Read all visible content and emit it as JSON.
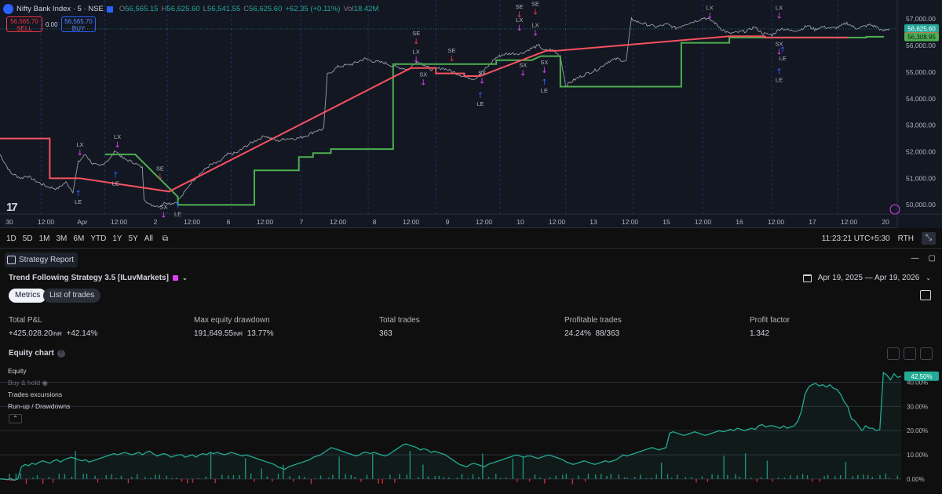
{
  "chart_header": {
    "symbol": "Nifty Bank Index · 5 · NSE",
    "open_label": "O",
    "open": "56,565.15",
    "high_label": "H",
    "high": "56,625.60",
    "low_label": "L",
    "low": "56,541.55",
    "close_label": "C",
    "close": "56,625.60",
    "change": "+62.35 (+0.11%)",
    "vol_label": "Vol",
    "vol": "18.42M",
    "sell_price": "56,565.70",
    "sell_label": "SELL",
    "buy_price": "56,565.70",
    "buy_label": "BUY",
    "spread": "0.00"
  },
  "price_axis": {
    "ticks": [
      "57,000.00",
      "56,000.00",
      "55,000.00",
      "54,000.00",
      "53,000.00",
      "52,000.00",
      "51,000.00",
      "50,000.00"
    ],
    "last_price": "56,625.60",
    "red_level": "56,324.00",
    "green_level": "56,308.95"
  },
  "time_axis": {
    "labels": [
      "30",
      "12:00",
      "Apr",
      "12:00",
      "2",
      "12:00",
      "6",
      "12:00",
      "7",
      "12:00",
      "8",
      "12:00",
      "9",
      "12:00",
      "10",
      "12:00",
      "13",
      "12:00",
      "15",
      "12:00",
      "16",
      "12:00",
      "17",
      "12:00",
      "20"
    ]
  },
  "signals": {
    "le": "LE",
    "lx": "LX",
    "se": "SE",
    "sx": "SX"
  },
  "chart_data": {
    "type": "line",
    "title": "Nifty Bank Index · 5 · NSE",
    "ylim": [
      49800,
      57300
    ],
    "price_path": [
      [
        0,
        51900
      ],
      [
        0.6,
        51200
      ],
      [
        1.2,
        51000
      ],
      [
        1.5,
        51100
      ],
      [
        2,
        50900
      ],
      [
        2.6,
        50700
      ],
      [
        3.2,
        50600
      ],
      [
        3.7,
        50850
      ],
      [
        4.1,
        50500
      ],
      [
        4.4,
        51600
      ],
      [
        4.8,
        51900
      ],
      [
        5.2,
        51550
      ],
      [
        5.6,
        51450
      ],
      [
        6.2,
        51750
      ],
      [
        6.5,
        52050
      ],
      [
        6.9,
        51750
      ],
      [
        7.5,
        51600
      ],
      [
        8,
        51400
      ],
      [
        8.1,
        50250
      ],
      [
        8.4,
        50000
      ],
      [
        9,
        49950
      ],
      [
        9.3,
        50100
      ],
      [
        9.6,
        50050
      ],
      [
        9.9,
        50100
      ],
      [
        10.2,
        50300
      ],
      [
        10.8,
        50900
      ],
      [
        11.3,
        51200
      ],
      [
        11.8,
        51500
      ],
      [
        12.3,
        51600
      ],
      [
        12.8,
        51900
      ],
      [
        13.3,
        51950
      ],
      [
        13.8,
        52200
      ],
      [
        14.3,
        52400
      ],
      [
        14.9,
        52600
      ],
      [
        15.6,
        52400
      ],
      [
        16.1,
        52500
      ],
      [
        16.7,
        52500
      ],
      [
        17.2,
        52600
      ],
      [
        17.8,
        52800
      ],
      [
        18.2,
        52850
      ],
      [
        18.4,
        54900
      ],
      [
        19,
        55200
      ],
      [
        19.8,
        55300
      ],
      [
        20.5,
        55500
      ],
      [
        21,
        55400
      ],
      [
        21.6,
        55350
      ],
      [
        22.2,
        55200
      ],
      [
        23,
        55100
      ],
      [
        23.4,
        55400
      ],
      [
        23.8,
        55300
      ],
      [
        24.2,
        55100
      ],
      [
        24.9,
        55150
      ],
      [
        25.5,
        55000
      ],
      [
        26.2,
        54800
      ],
      [
        26.7,
        54750
      ],
      [
        27.1,
        55000
      ],
      [
        27.5,
        55250
      ],
      [
        27.8,
        55500
      ],
      [
        28.2,
        55650
      ],
      [
        28.7,
        55700
      ],
      [
        29.3,
        55700
      ],
      [
        29.9,
        55900
      ],
      [
        30.3,
        56000
      ],
      [
        30.6,
        55800
      ],
      [
        31,
        55850
      ],
      [
        31.5,
        55600
      ],
      [
        31.8,
        54500
      ],
      [
        32.4,
        54750
      ],
      [
        33,
        54950
      ],
      [
        33.6,
        55100
      ],
      [
        34.2,
        55400
      ],
      [
        34.7,
        55500
      ],
      [
        35.2,
        55400
      ],
      [
        35.5,
        57000
      ],
      [
        35.8,
        56900
      ],
      [
        36.3,
        56800
      ],
      [
        36.9,
        56700
      ],
      [
        37.5,
        56800
      ],
      [
        38,
        56650
      ],
      [
        38.5,
        56800
      ],
      [
        39,
        56900
      ],
      [
        39.6,
        57050
      ],
      [
        40.1,
        56900
      ],
      [
        40.6,
        56600
      ],
      [
        41,
        56450
      ],
      [
        41.5,
        56500
      ],
      [
        42,
        56550
      ],
      [
        42.4,
        56700
      ],
      [
        42.9,
        56450
      ],
      [
        43.4,
        56400
      ],
      [
        43.9,
        56650
      ],
      [
        44.5,
        56550
      ],
      [
        45,
        56600
      ],
      [
        45.4,
        56750
      ],
      [
        45.8,
        56600
      ],
      [
        46.2,
        56700
      ],
      [
        46.8,
        56650
      ],
      [
        47.2,
        56700
      ],
      [
        47.6,
        56850
      ],
      [
        48.1,
        56650
      ],
      [
        48.5,
        56700
      ],
      [
        48.9,
        56780
      ],
      [
        49.3,
        56700
      ],
      [
        49.6,
        56540
      ],
      [
        50,
        56625
      ]
    ],
    "red_stop": [
      [
        0,
        52500
      ],
      [
        2.8,
        52500
      ],
      [
        2.8,
        51000
      ],
      [
        4.5,
        51000
      ],
      [
        9.5,
        50500
      ],
      [
        23.1,
        55150
      ],
      [
        24.5,
        55150
      ],
      [
        24.5,
        54950
      ],
      [
        26.1,
        54950
      ],
      [
        26.1,
        54850
      ],
      [
        27,
        54850
      ],
      [
        30.7,
        55800
      ],
      [
        31.3,
        55800
      ],
      [
        41,
        56350
      ],
      [
        43,
        56350
      ],
      [
        43,
        56300
      ],
      [
        47.7,
        56300
      ]
    ],
    "green_stop": [
      [
        5.9,
        51900
      ],
      [
        6.8,
        51900
      ],
      [
        7.6,
        51900
      ],
      [
        10,
        50300
      ],
      [
        10,
        50000
      ],
      [
        14.3,
        50000
      ],
      [
        14.3,
        51300
      ],
      [
        16.8,
        51300
      ],
      [
        16.8,
        51800
      ],
      [
        17.6,
        51800
      ],
      [
        17.6,
        51950
      ],
      [
        18.6,
        51950
      ],
      [
        18.6,
        52100
      ],
      [
        22.1,
        52100
      ],
      [
        22.1,
        55300
      ],
      [
        24.5,
        55300
      ],
      [
        27.9,
        55300
      ],
      [
        27.9,
        55450
      ],
      [
        29.9,
        55450
      ],
      [
        30.4,
        55600
      ],
      [
        31.5,
        55600
      ],
      [
        31.5,
        54450
      ],
      [
        38.3,
        54450
      ],
      [
        38.3,
        56100
      ],
      [
        41,
        56100
      ],
      [
        41,
        56300
      ],
      [
        47.6,
        56300
      ],
      [
        47.7,
        56300
      ],
      [
        48.7,
        56300
      ],
      [
        48.7,
        56330
      ],
      [
        49.7,
        56330
      ]
    ]
  },
  "timeframes": [
    "1D",
    "5D",
    "1M",
    "3M",
    "6M",
    "YTD",
    "1Y",
    "5Y",
    "All"
  ],
  "time_toolbar": {
    "clock": "11:23:21 UTC+5:30",
    "session": "RTH"
  },
  "report": {
    "tab_label": "Strategy Report",
    "strategy_name": "Trend Following Strategy 3.5 [ILuvMarkets]",
    "date_range": "Apr 19, 2025 — Apr 19, 2026",
    "tabs": [
      "Metrics",
      "List of trades"
    ],
    "metrics": [
      {
        "label": "Total P&L",
        "value": "+425,028.20",
        "unit": "INR",
        "extra": "+42.14%"
      },
      {
        "label": "Max equity drawdown",
        "value": "191,649.55",
        "unit": "INR",
        "extra": "13.77%"
      },
      {
        "label": "Total trades",
        "value": "363"
      },
      {
        "label": "Profitable trades",
        "value": "24.24%",
        "extra": "88/363"
      },
      {
        "label": "Profit factor",
        "value": "1.342"
      }
    ],
    "equity_title": "Equity chart",
    "legend": [
      "Equity",
      "Buy & hold",
      "Trades excursions",
      "Run-up / Drawdowns"
    ]
  },
  "equity_chart": {
    "type": "area",
    "ylim": [
      -2,
      46
    ],
    "y_ticks": [
      "40.00%",
      "30.00%",
      "20.00%",
      "10.00%",
      "0.00%"
    ],
    "tick_values": [
      40,
      30,
      20,
      10,
      0
    ],
    "last_value": "42.50%",
    "last_value_num": 42.5,
    "colors": {
      "line": "#22ab94",
      "fill": "#22ab94"
    },
    "values": [
      0,
      0,
      -0.3,
      0.2,
      -0.5,
      0,
      5,
      6,
      5.5,
      6.5,
      6,
      7,
      7.5,
      7,
      6.5,
      7.5,
      8,
      7,
      8,
      8.5,
      9,
      8.5,
      8,
      7.5,
      8,
      7,
      7.5,
      8,
      8.5,
      9,
      9.5,
      10,
      10.5,
      10,
      10.5,
      11,
      10.5,
      10,
      10.5,
      11,
      10,
      11,
      11.5,
      10.5,
      9.5,
      10,
      10.5,
      10,
      9,
      9.5,
      10,
      10,
      9,
      9.5,
      10,
      9,
      10,
      10.5,
      10,
      11,
      10.5,
      11,
      10.5,
      10,
      10.5,
      11,
      10.5,
      10,
      9.5,
      10,
      9.5,
      9,
      8.5,
      8,
      7.5,
      7,
      6.5,
      6,
      5,
      4.5,
      4,
      5,
      5.5,
      6,
      6.5,
      7,
      7.5,
      8,
      9,
      9.5,
      10,
      11,
      12,
      13,
      12.5,
      12,
      11.5,
      11,
      10.5,
      10,
      9.5,
      10,
      11,
      11,
      10.5,
      11,
      10.5,
      10,
      9.5,
      10,
      11,
      12,
      13,
      14,
      14.5,
      14,
      13.5,
      13,
      12,
      12.5,
      12,
      11,
      11.5,
      11,
      10.5,
      10,
      9,
      8,
      7,
      6,
      5.5,
      5,
      6,
      6.5,
      6,
      5.5,
      5,
      6,
      6.5,
      7,
      7.5,
      8,
      8.5,
      9,
      9.5,
      10,
      9.5,
      9,
      9.5,
      9.5,
      9,
      8.5,
      9,
      9.5,
      10,
      9.5,
      9,
      8.5,
      8,
      7,
      6.5,
      6,
      6.5,
      7,
      7.5,
      7,
      6.5,
      6,
      6.5,
      7,
      7.5,
      7,
      7.5,
      8,
      9,
      10,
      9.5,
      10,
      10.5,
      11,
      11.5,
      12,
      12.5,
      13,
      12.5,
      12,
      12.5,
      13,
      19,
      19.5,
      19,
      18.5,
      18,
      18.5,
      19,
      19.5,
      19,
      18.5,
      18,
      18.5,
      19,
      19.5,
      20,
      19.5,
      20,
      20.5,
      20,
      21,
      20.5,
      20,
      20.5,
      21,
      20.5,
      22,
      22.5,
      21.5,
      22,
      22,
      21.5,
      21,
      22,
      21,
      21.5,
      22,
      24,
      28,
      35,
      38,
      39,
      39.5,
      38.5,
      39,
      38,
      39,
      37.5,
      37,
      35,
      32,
      30,
      25,
      24,
      22,
      20,
      22,
      21,
      21,
      20,
      20.5,
      44,
      43,
      41,
      43.5,
      42,
      42.5
    ]
  }
}
